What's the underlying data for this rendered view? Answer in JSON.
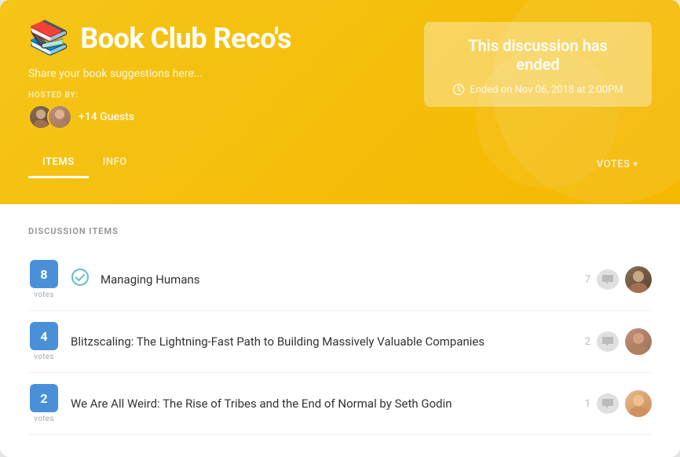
{
  "header": {
    "emoji": "📚",
    "title": "Book Club Reco's",
    "subtitle": "Share your book suggestions here...",
    "hosted_by_label": "HOSTED BY:",
    "guests_label": "+14 Guests",
    "ended_text": "This discussion has ended",
    "ended_timestamp": "Ended on Nov 06, 2018 at 2:00PM"
  },
  "tabs": {
    "items_label": "ITEMS",
    "info_label": "INFO",
    "votes_label": "VOTES"
  },
  "content": {
    "section_label": "DISCUSSION ITEMS",
    "items": [
      {
        "votes": "8",
        "votes_label": "votes",
        "checked": true,
        "title": "Managing Humans",
        "comment_count": "7"
      },
      {
        "votes": "4",
        "votes_label": "votes",
        "checked": false,
        "title": "Blitzscaling: The Lightning-Fast Path to Building Massively Valuable Companies",
        "comment_count": "2"
      },
      {
        "votes": "2",
        "votes_label": "votes",
        "checked": false,
        "title": "We Are All Weird: The Rise of Tribes and the End of Normal by Seth Godin",
        "comment_count": "1"
      }
    ]
  }
}
